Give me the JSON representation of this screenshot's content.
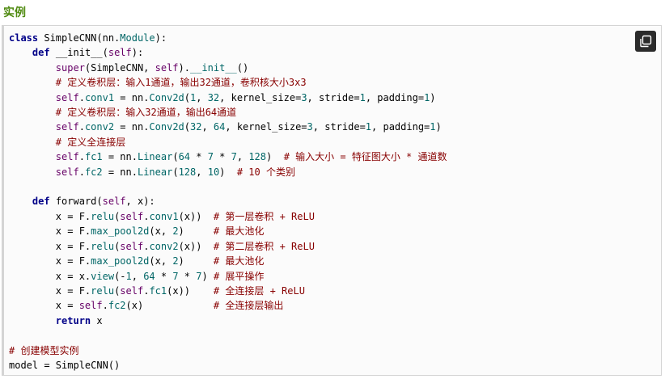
{
  "section": {
    "title": "实例"
  },
  "code": {
    "lines": [
      "class SimpleCNN(nn.Module):",
      "    def __init__(self):",
      "        super(SimpleCNN, self).__init__()",
      "        # 定义卷积层：输入1通道，输出32通道，卷积核大小3x3",
      "        self.conv1 = nn.Conv2d(1, 32, kernel_size=3, stride=1, padding=1)",
      "        # 定义卷积层：输入32通道，输出64通道",
      "        self.conv2 = nn.Conv2d(32, 64, kernel_size=3, stride=1, padding=1)",
      "        # 定义全连接层",
      "        self.fc1 = nn.Linear(64 * 7 * 7, 128)  # 输入大小 = 特征图大小 * 通道数",
      "        self.fc2 = nn.Linear(128, 10)  # 10 个类别",
      "",
      "    def forward(self, x):",
      "        x = F.relu(self.conv1(x))  # 第一层卷积 + ReLU",
      "        x = F.max_pool2d(x, 2)     # 最大池化",
      "        x = F.relu(self.conv2(x))  # 第二层卷积 + ReLU",
      "        x = F.max_pool2d(x, 2)     # 最大池化",
      "        x = x.view(-1, 64 * 7 * 7) # 展平操作",
      "        x = F.relu(self.fc1(x))    # 全连接层 + ReLU",
      "        x = self.fc2(x)            # 全连接层输出",
      "        return x",
      "",
      "# 创建模型实例",
      "model = SimpleCNN()"
    ]
  },
  "copy_button": {
    "icon": "copy-icon"
  }
}
